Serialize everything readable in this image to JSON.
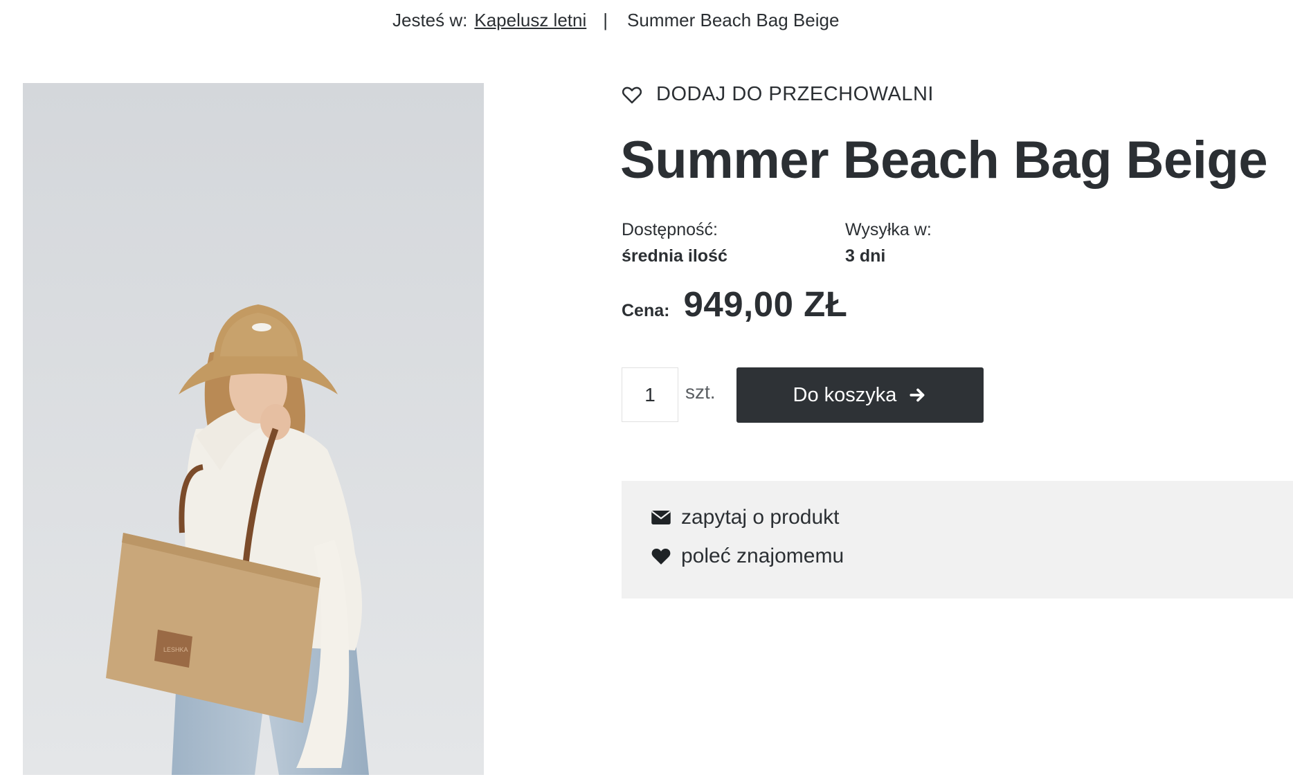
{
  "breadcrumb": {
    "prefix": "Jesteś w:",
    "parent": "Kapelusz letni",
    "separator": "|",
    "current": "Summer Beach Bag Beige"
  },
  "product": {
    "wishlist_label": "DODAJ DO PRZECHOWALNI",
    "title": "Summer Beach Bag Beige",
    "availability_label": "Dostępność:",
    "availability_value": "średnia ilość",
    "shipping_label": "Wysyłka w:",
    "shipping_value": "3 dni",
    "price_label": "Cena:",
    "price_value": "949,00 ZŁ",
    "quantity": "1",
    "quantity_unit": "szt.",
    "add_to_cart_label": "Do koszyka",
    "image_logo_text": "LESHKA"
  },
  "actions": {
    "ask_label": "zapytaj o produkt",
    "recommend_label": "poleć znajomemu"
  },
  "icons": {
    "wishlist": "heart-outline-icon",
    "cart_arrow": "arrow-right-icon",
    "ask": "envelope-icon",
    "recommend": "heart-icon"
  },
  "colors": {
    "text": "#2b2f33",
    "button": "#2e3236",
    "info_box": "#f1f1f1",
    "photo_bg": "#dadde1"
  }
}
